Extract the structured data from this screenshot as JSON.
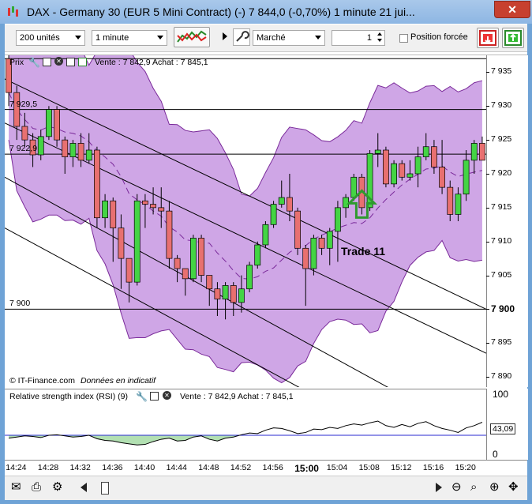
{
  "window": {
    "title": "DAX - Germany 30 (EUR 5 Mini Contract) (-)   7 844,0 (-0,70%)   1 minute  21 jui..."
  },
  "toolbar": {
    "units_value": "200 unités",
    "interval_value": "1 minute",
    "order_type_value": "Marché",
    "quantity_value": "1",
    "forced_position_label": "Position forcée"
  },
  "chart_header": {
    "label": "Prix",
    "quote_text": "Vente : 7 842,9 Achat : 7 845,1"
  },
  "rsi_header": {
    "label": "Relative strength index (RSI) (9)",
    "quote_text": "Vente : 7 842,9 Achat : 7 845,1"
  },
  "price_axis": {
    "ticks": [
      "7 935",
      "7 930",
      "7 925",
      "7 920",
      "7 915",
      "7 910",
      "7 905",
      "7 900",
      "7 895",
      "7 890"
    ]
  },
  "rsi_axis": {
    "ticks": [
      "100",
      "0"
    ],
    "current_value": "43,09"
  },
  "time_axis": {
    "ticks": [
      "14:24",
      "14:28",
      "14:32",
      "14:36",
      "14:40",
      "14:44",
      "14:48",
      "14:52",
      "14:56",
      "15:00",
      "15:04",
      "15:08",
      "15:12",
      "15:16",
      "15:20"
    ]
  },
  "levels": {
    "l1": "7 929,5",
    "l2": "7 922,9",
    "l3": "7 900"
  },
  "annotations": {
    "trade": "Trade 11",
    "source": "© IT-Finance.com",
    "note": "Données en indicatif"
  },
  "colors": {
    "bull": "#44d444",
    "bear": "#e87070",
    "band": "#cfa6e6",
    "band_line": "#7a2a9a",
    "arrow": "#2f9a2f"
  },
  "chart_data": {
    "type": "candlestick",
    "x": [
      "14:23",
      "14:24",
      "14:25",
      "14:26",
      "14:27",
      "14:28",
      "14:29",
      "14:30",
      "14:31",
      "14:32",
      "14:33",
      "14:34",
      "14:35",
      "14:36",
      "14:37",
      "14:38",
      "14:39",
      "14:40",
      "14:41",
      "14:42",
      "14:43",
      "14:44",
      "14:45",
      "14:46",
      "14:47",
      "14:48",
      "14:49",
      "14:50",
      "14:51",
      "14:52",
      "14:53",
      "14:54",
      "14:55",
      "14:56",
      "14:57",
      "14:58",
      "14:59",
      "15:00",
      "15:01",
      "15:02",
      "15:03",
      "15:04",
      "15:05",
      "15:06",
      "15:07",
      "15:08",
      "15:09",
      "15:10",
      "15:11",
      "15:12",
      "15:13",
      "15:14",
      "15:15",
      "15:16",
      "15:17",
      "15:18",
      "15:19",
      "15:20",
      "15:21",
      "15:22"
    ],
    "ohlc": [
      [
        7937,
        7937.5,
        7930,
        7932
      ],
      [
        7932,
        7933,
        7925,
        7927
      ],
      [
        7927,
        7929,
        7924,
        7925
      ],
      [
        7925,
        7926,
        7921,
        7922.8
      ],
      [
        7922.8,
        7926.5,
        7922,
        7925.5
      ],
      [
        7925.5,
        7930,
        7925,
        7929.5
      ],
      [
        7929.5,
        7930,
        7924,
        7925
      ],
      [
        7925,
        7925.5,
        7920,
        7922.5
      ],
      [
        7922.5,
        7925,
        7921,
        7924.5
      ],
      [
        7924.5,
        7926,
        7921,
        7922
      ],
      [
        7922,
        7926,
        7921.5,
        7923.5
      ],
      [
        7923.5,
        7924,
        7912,
        7913.5
      ],
      [
        7913.5,
        7917,
        7912,
        7916
      ],
      [
        7916,
        7916.5,
        7907,
        7912
      ],
      [
        7912,
        7914,
        7903,
        7907.5
      ],
      [
        7907.5,
        7907.5,
        7901,
        7904
      ],
      [
        7904,
        7917,
        7903.5,
        7916
      ],
      [
        7916,
        7917,
        7912,
        7915.5
      ],
      [
        7915.5,
        7918,
        7914,
        7915
      ],
      [
        7915,
        7918,
        7912,
        7914.5
      ],
      [
        7914.5,
        7916,
        7906,
        7907.5
      ],
      [
        7907.5,
        7908,
        7904,
        7906
      ],
      [
        7906,
        7906,
        7902,
        7904.5
      ],
      [
        7904.5,
        7911,
        7904,
        7910.5
      ],
      [
        7910.5,
        7911,
        7904,
        7905
      ],
      [
        7905,
        7905,
        7900.5,
        7903
      ],
      [
        7903,
        7904,
        7899,
        7901.5
      ],
      [
        7901.5,
        7904,
        7898.5,
        7903.5
      ],
      [
        7903.5,
        7904,
        7899,
        7901
      ],
      [
        7901,
        7905,
        7899.5,
        7903
      ],
      [
        7903,
        7907,
        7902.5,
        7906.5
      ],
      [
        7906.5,
        7910,
        7906,
        7909.5
      ],
      [
        7909.5,
        7913,
        7909,
        7912.5
      ],
      [
        7912.5,
        7916,
        7912,
        7915.5
      ],
      [
        7915.5,
        7919,
        7915,
        7916.5
      ],
      [
        7916.5,
        7920,
        7913,
        7914.5
      ],
      [
        7914.5,
        7915,
        7908,
        7909
      ],
      [
        7909,
        7909.5,
        7900.5,
        7906
      ],
      [
        7906,
        7911,
        7905,
        7910.5
      ],
      [
        7910.5,
        7911,
        7908,
        7909
      ],
      [
        7909,
        7912,
        7906.5,
        7911.5
      ],
      [
        7911.5,
        7916,
        7907,
        7915
      ],
      [
        7915,
        7917,
        7913.5,
        7916.5
      ],
      [
        7916.5,
        7920,
        7916,
        7919.5
      ],
      [
        7919.5,
        7920,
        7914,
        7915
      ],
      [
        7915,
        7923.5,
        7914.5,
        7923
      ],
      [
        7923,
        7926,
        7921,
        7923.5
      ],
      [
        7923.5,
        7924,
        7918,
        7918.5
      ],
      [
        7918.5,
        7922,
        7918,
        7921.5
      ],
      [
        7921.5,
        7922,
        7919,
        7919.5
      ],
      [
        7919.5,
        7922,
        7919,
        7920
      ],
      [
        7920,
        7924,
        7918,
        7922.5
      ],
      [
        7922.5,
        7926,
        7922,
        7924
      ],
      [
        7924,
        7925,
        7920,
        7921
      ],
      [
        7921,
        7925,
        7917,
        7918
      ],
      [
        7918,
        7919,
        7913,
        7914
      ],
      [
        7914,
        7918,
        7913,
        7917
      ],
      [
        7917,
        7923.5,
        7916,
        7922
      ],
      [
        7922,
        7925,
        7920,
        7924.5
      ],
      [
        7924.5,
        7925.5,
        7922,
        7922
      ]
    ],
    "ylim": [
      7888.5,
      7937.5
    ],
    "rsi": [
      38,
      40,
      42,
      41,
      39,
      43,
      44,
      42,
      40,
      41,
      43,
      37,
      34,
      33,
      30,
      28,
      26,
      27,
      32,
      36,
      38,
      33,
      34,
      40,
      42,
      36,
      33,
      38,
      40,
      44,
      47,
      46,
      52,
      56,
      55,
      51,
      46,
      48,
      54,
      53,
      57,
      55,
      60,
      63,
      61,
      65,
      68,
      60,
      57,
      62,
      58,
      64,
      67,
      60,
      55,
      52,
      48,
      56,
      60,
      66
    ],
    "rsi_ylim": [
      0,
      100
    ],
    "rsi_mid": 43.09
  }
}
